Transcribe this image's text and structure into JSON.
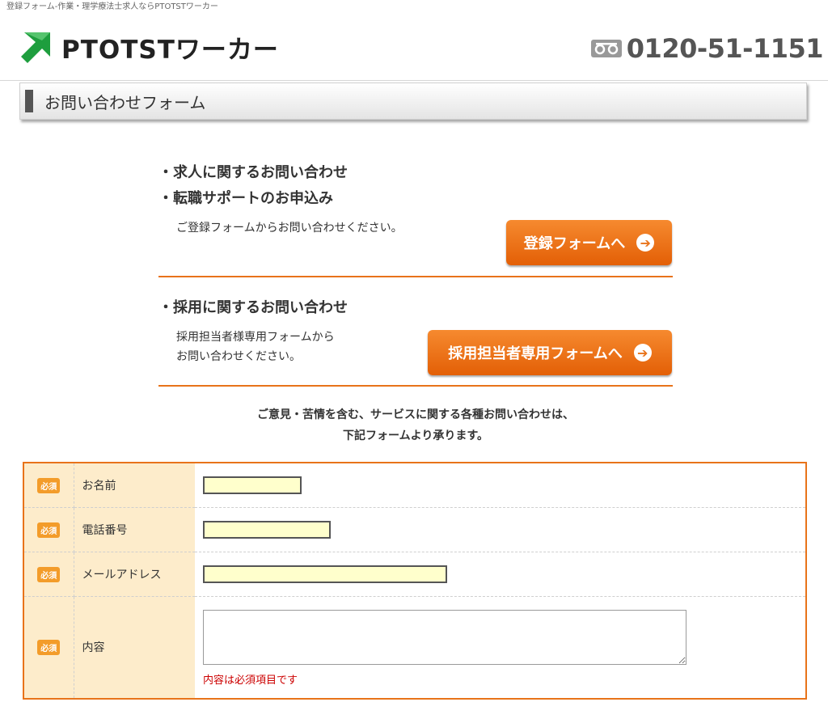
{
  "browser_title": "登録フォーム-作業・理学療法士求人ならPTOTSTワーカー",
  "header": {
    "logo_text": "PTOTSTワーカー",
    "phone_icon": "free-dial-icon",
    "phone_number": "0120-51-1151"
  },
  "page_title": "お問い合わせフォーム",
  "sections": {
    "jobseeker": {
      "heading1": "・求人に関するお問い合わせ",
      "heading2": "・転職サポートのお申込み",
      "desc": "ご登録フォームからお問い合わせください。",
      "button_label": "登録フォームへ"
    },
    "employer": {
      "heading": "・採用に関するお問い合わせ",
      "desc_line1": "採用担当者様専用フォームから",
      "desc_line2": "お問い合わせください。",
      "button_label": "採用担当者専用フォームへ"
    }
  },
  "notice": {
    "line1": "ご意見・苦情を含む、サービスに関する各種お問い合わせは、",
    "line2": "下記フォームより承ります。"
  },
  "form": {
    "required_badge": "必須",
    "fields": [
      {
        "label": "お名前",
        "value": ""
      },
      {
        "label": "電話番号",
        "value": ""
      },
      {
        "label": "メールアドレス",
        "value": ""
      },
      {
        "label": "内容",
        "value": "",
        "error": "内容は必須項目です"
      }
    ]
  },
  "colors": {
    "accent_orange": "#e8731a",
    "logo_green": "#1e9e3e",
    "label_bg": "#fdeccb",
    "input_bg": "#ffffcc",
    "error_red": "#cc0000"
  }
}
